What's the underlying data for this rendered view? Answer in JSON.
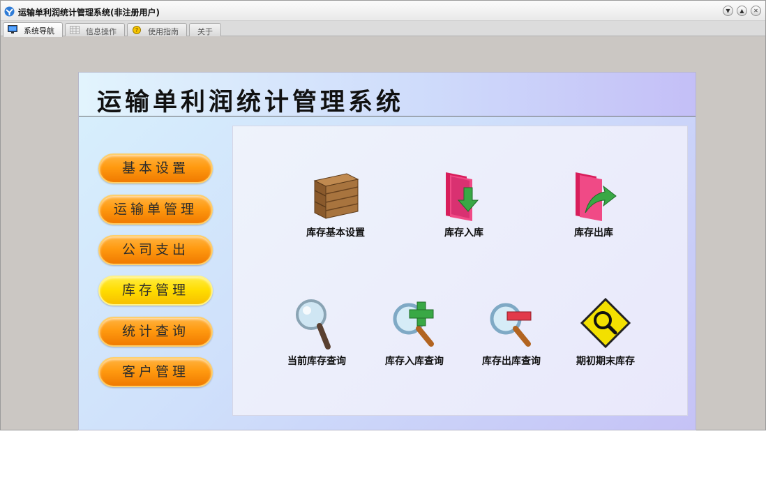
{
  "window": {
    "title": "运输单利润统计管理系统(非注册用户)"
  },
  "tabs": [
    {
      "label": "系统导航",
      "icon": "monitor-icon",
      "active": true
    },
    {
      "label": "信息操作",
      "icon": "grid-icon",
      "active": false
    },
    {
      "label": "使用指南",
      "icon": "guide-icon",
      "active": false
    },
    {
      "label": "关于",
      "icon": "",
      "active": false
    }
  ],
  "banner": {
    "title": "运输单利润统计管理系统"
  },
  "nav": [
    {
      "label": "基本设置",
      "selected": false
    },
    {
      "label": "运输单管理",
      "selected": false
    },
    {
      "label": "公司支出",
      "selected": false
    },
    {
      "label": "库存管理",
      "selected": true
    },
    {
      "label": "统计查询",
      "selected": false
    },
    {
      "label": "客户管理",
      "selected": false
    }
  ],
  "functions": [
    {
      "label": "库存基本设置",
      "icon": "wooden-crate-icon"
    },
    {
      "label": "库存入库",
      "icon": "folder-arrow-down-icon"
    },
    {
      "label": "库存出库",
      "icon": "folder-arrow-out-icon"
    },
    {
      "label": "当前库存查询",
      "icon": "magnifier-icon"
    },
    {
      "label": "库存入库查询",
      "icon": "magnifier-plus-icon"
    },
    {
      "label": "库存出库查询",
      "icon": "magnifier-minus-icon"
    },
    {
      "label": "期初期末库存",
      "icon": "diamond-sign-magnifier-icon"
    }
  ],
  "colors": {
    "nav_orange": "#ff9a10",
    "nav_selected": "#ffdc00",
    "panel_gradient_start": "#d8f0fc",
    "panel_gradient_end": "#c5c2f6"
  }
}
